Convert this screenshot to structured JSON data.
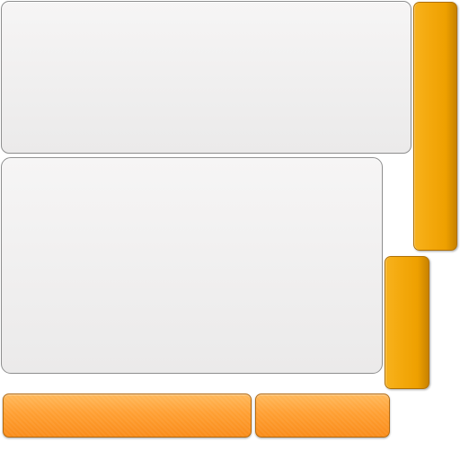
{
  "colors": {
    "panel_top": "#f6f5f5",
    "panel_bottom": "#ebeaea",
    "panel_border": "#8e8e8e",
    "vertical_bar": "#f4a90d",
    "vertical_bar_dark": "#c88200",
    "horizontal_button": "#ff9f32",
    "horizontal_button_border": "#b46a10"
  }
}
